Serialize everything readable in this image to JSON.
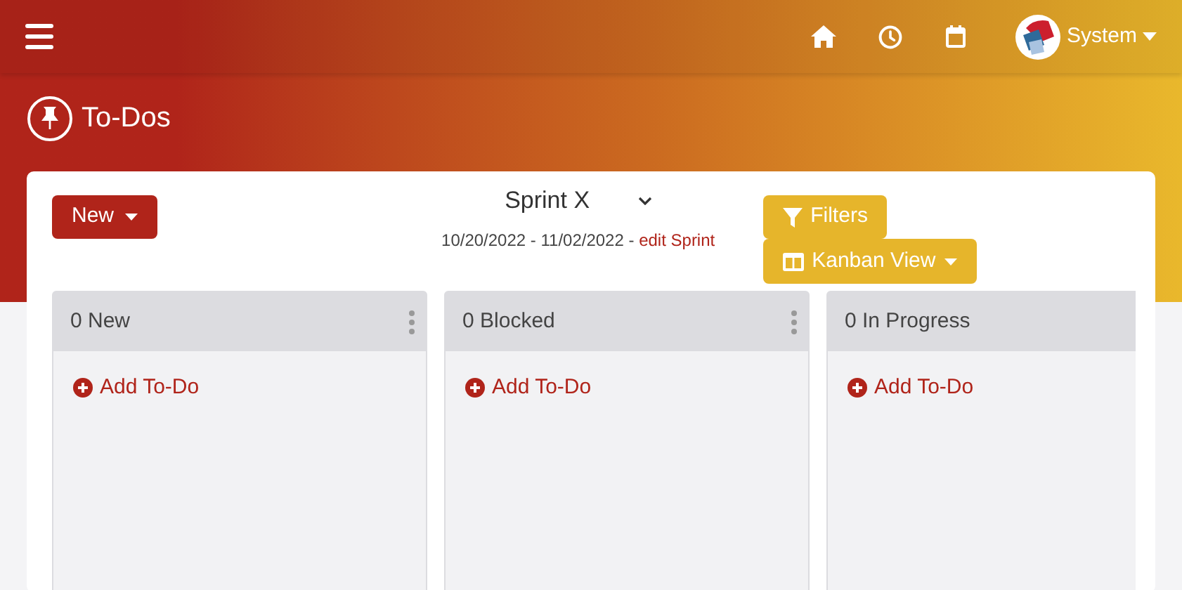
{
  "header": {
    "user": "System"
  },
  "page": {
    "title": "To-Dos"
  },
  "toolbar": {
    "new_button": "New",
    "sprint": "Sprint X",
    "dates": "10/20/2022 - 11/02/2022 - ",
    "edit_link": "edit Sprint",
    "filters_button": "Filters",
    "view_button": "Kanban View"
  },
  "columns": [
    {
      "title": "0 New",
      "add": "Add To-Do"
    },
    {
      "title": "0 Blocked",
      "add": "Add To-Do"
    },
    {
      "title": "0 In Progress",
      "add": "Add To-Do"
    }
  ]
}
